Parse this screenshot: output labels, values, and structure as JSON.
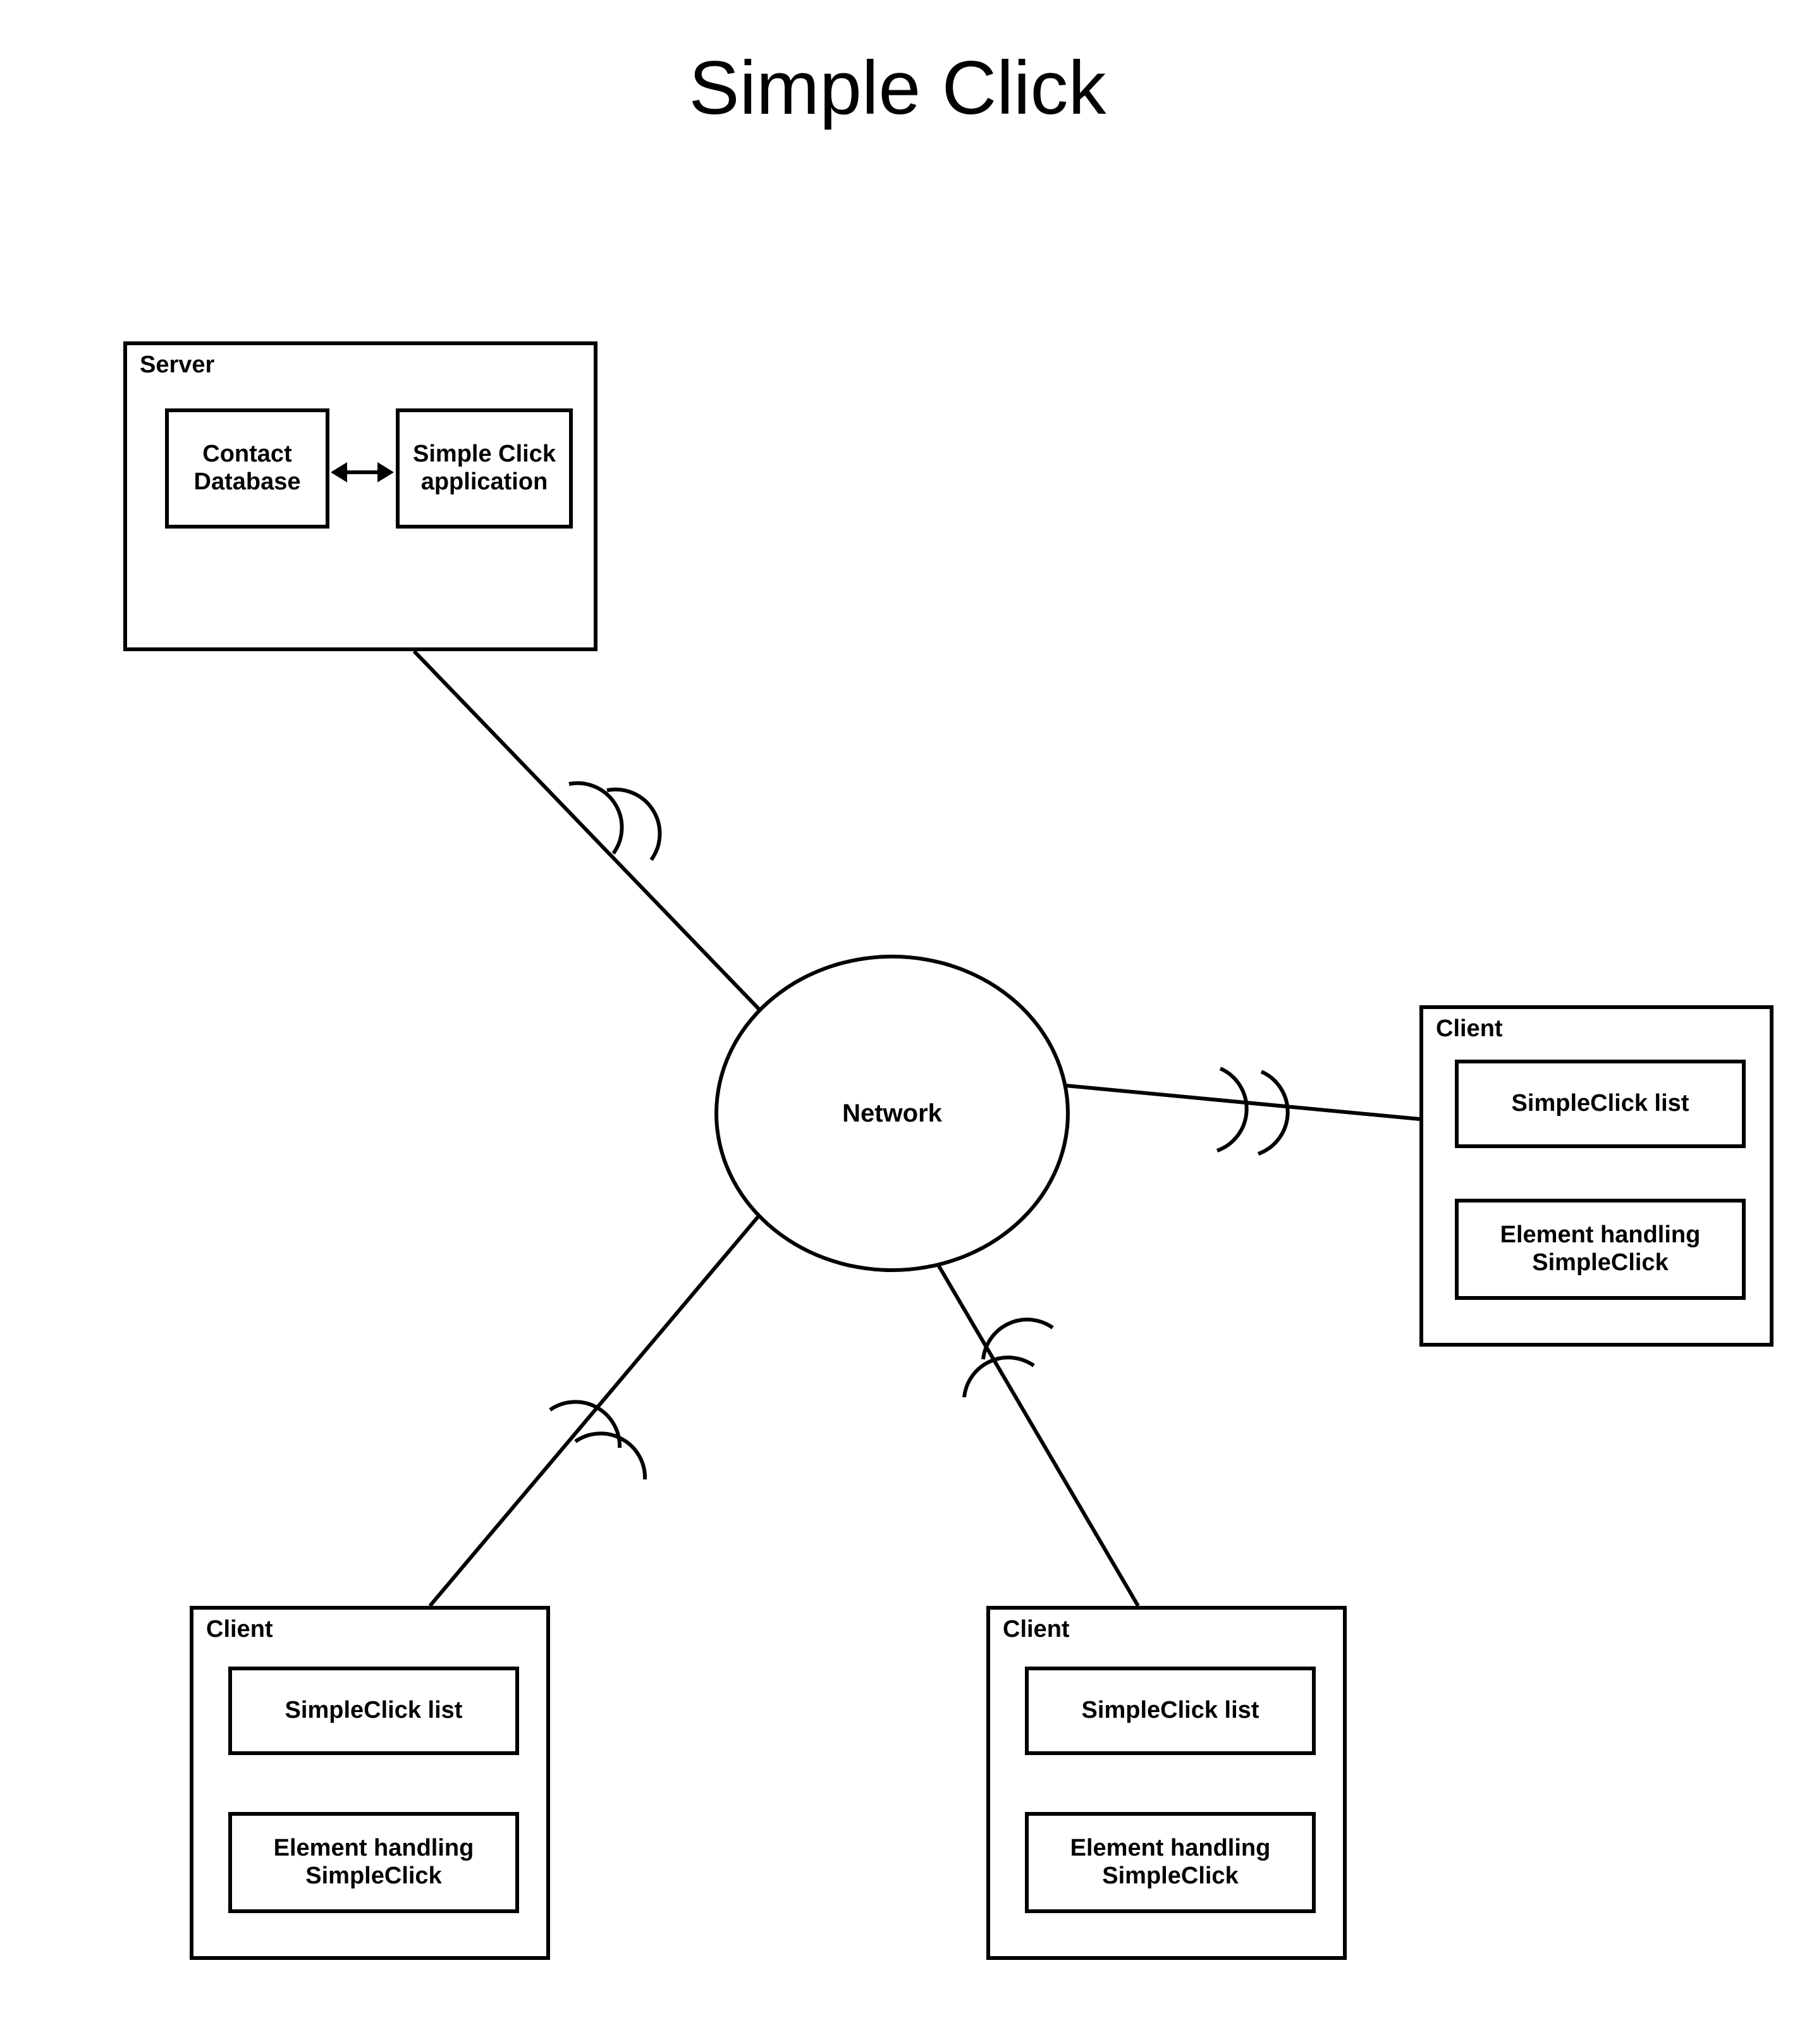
{
  "title": "Simple Click",
  "network_label": "Network",
  "server": {
    "label": "Server",
    "left_box": "Contact Database",
    "right_box": "Simple Click application"
  },
  "clients": [
    {
      "label": "Client",
      "list": "SimpleClick list",
      "handler": "Element handling SimpleClick"
    },
    {
      "label": "Client",
      "list": "SimpleClick list",
      "handler": "Element handling SimpleClick"
    },
    {
      "label": "Client",
      "list": "SimpleClick list",
      "handler": "Element handling SimpleClick"
    }
  ]
}
